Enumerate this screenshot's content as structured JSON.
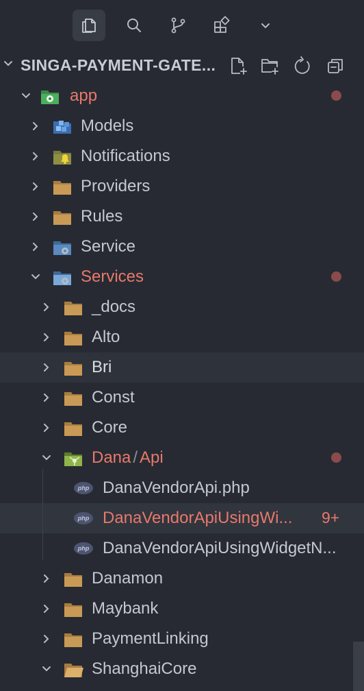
{
  "activity_bar": {
    "icons": [
      "explorer-icon",
      "search-icon",
      "source-control-icon",
      "extensions-icon",
      "chevron-down-icon"
    ]
  },
  "explorer": {
    "title": "SINGA-PAYMENT-GATE...",
    "actions": [
      "new-file-icon",
      "new-folder-icon",
      "refresh-icon",
      "collapse-all-icon"
    ]
  },
  "tree": [
    {
      "label": "app",
      "modified": true,
      "dot": true
    },
    {
      "label": "Models"
    },
    {
      "label": "Notifications"
    },
    {
      "label": "Providers"
    },
    {
      "label": "Rules"
    },
    {
      "label": "Service"
    },
    {
      "label": "Services",
      "modified": true,
      "dot": true
    },
    {
      "label": "_docs"
    },
    {
      "label": "Alto"
    },
    {
      "label": "Bri"
    },
    {
      "label": "Const"
    },
    {
      "label": "Core"
    },
    {
      "label": "Dana",
      "label2": "Api",
      "separator": "/",
      "modified": true,
      "dot": true
    },
    {
      "label": "DanaVendorApi.php",
      "icon_text": "php"
    },
    {
      "label": "DanaVendorApiUsingWi...",
      "icon_text": "php",
      "modified": true,
      "badge": "9+"
    },
    {
      "label": "DanaVendorApiUsingWidgetN...",
      "icon_text": "php"
    },
    {
      "label": "Danamon"
    },
    {
      "label": "Maybank"
    },
    {
      "label": "PaymentLinking"
    },
    {
      "label": "ShanghaiCore"
    }
  ],
  "colors": {
    "background": "#272a33",
    "folder": "#b88a4a",
    "modified": "#e8796a",
    "dot": "#8c4b4b"
  }
}
